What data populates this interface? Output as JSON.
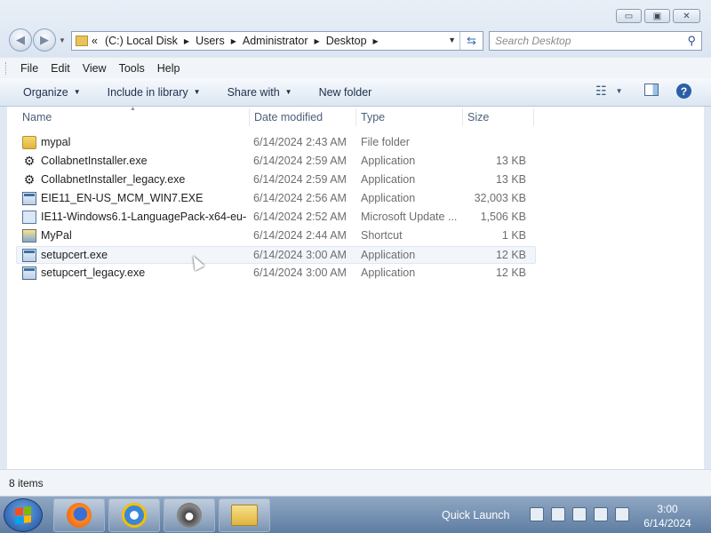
{
  "window": {
    "controls": {
      "minimize": "▭",
      "maximize": "▣",
      "close": "✕"
    }
  },
  "address": {
    "prefix": "«",
    "crumbs": [
      "(C:) Local Disk",
      "Users",
      "Administrator",
      "Desktop"
    ]
  },
  "search": {
    "placeholder": "Search Desktop"
  },
  "menubar": {
    "items": [
      "File",
      "Edit",
      "View",
      "Tools",
      "Help"
    ]
  },
  "toolbar": {
    "organize": "Organize",
    "include_in_library": "Include in library",
    "share_with": "Share with",
    "new_folder": "New folder"
  },
  "columns": {
    "name": "Name",
    "date": "Date modified",
    "type": "Type",
    "size": "Size"
  },
  "files": [
    {
      "name": "mypal",
      "date": "6/14/2024 2:43 AM",
      "type": "File folder",
      "size": "",
      "icon": "folder-icon"
    },
    {
      "name": "CollabnetInstaller.exe",
      "date": "6/14/2024 2:59 AM",
      "type": "Application",
      "size": "13 KB",
      "icon": "installer-icon"
    },
    {
      "name": "CollabnetInstaller_legacy.exe",
      "date": "6/14/2024 2:59 AM",
      "type": "Application",
      "size": "13 KB",
      "icon": "installer-icon"
    },
    {
      "name": "EIE11_EN-US_MCM_WIN7.EXE",
      "date": "6/14/2024 2:56 AM",
      "type": "Application",
      "size": "32,003 KB",
      "icon": "application-icon"
    },
    {
      "name": "IE11-Windows6.1-LanguagePack-x64-eu-...",
      "date": "6/14/2024 2:52 AM",
      "type": "Microsoft Update ...",
      "size": "1,506 KB",
      "icon": "update-package-icon"
    },
    {
      "name": "MyPal",
      "date": "6/14/2024 2:44 AM",
      "type": "Shortcut",
      "size": "1 KB",
      "icon": "shortcut-icon"
    },
    {
      "name": "setupcert.exe",
      "date": "6/14/2024 3:00 AM",
      "type": "Application",
      "size": "12 KB",
      "icon": "application-icon"
    },
    {
      "name": "setupcert_legacy.exe",
      "date": "6/14/2024 3:00 AM",
      "type": "Application",
      "size": "12 KB",
      "icon": "application-icon"
    }
  ],
  "status": {
    "items_count": "8 items"
  },
  "taskbar": {
    "quick_launch": "Quick Launch",
    "time": "3:00",
    "date": "6/14/2024"
  }
}
